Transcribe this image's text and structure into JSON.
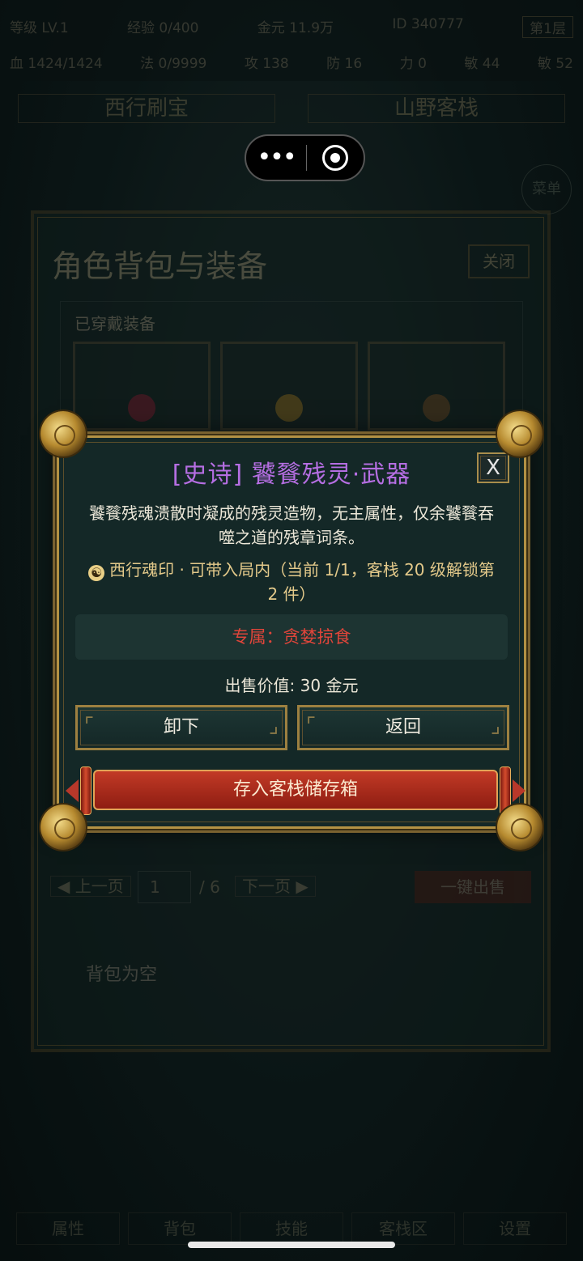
{
  "status": {
    "row1": [
      "等级 LV.1",
      "经验 0/400",
      "金元 11.9万",
      "ID 340777"
    ],
    "level_button": "第1层",
    "row2": [
      "血 1424/1424",
      "法 0/9999",
      "攻 138",
      "防 16",
      "力 0",
      "敏 44",
      "敏 52"
    ]
  },
  "nav": {
    "tab1": "西行刷宝",
    "tab2": "山野客栈"
  },
  "menu_label": "菜单",
  "bag": {
    "title": "角色背包与装备",
    "close_label": "关闭",
    "equipped_label": "已穿戴装备",
    "prev_page": "上一页",
    "page": "1",
    "page_total": "/ 6",
    "next_page": "下一页",
    "sell_all": "一键出售",
    "empty_text": "背包为空"
  },
  "dialog": {
    "title": "[史诗] 饕餮残灵·武器",
    "close_x": "X",
    "description": "饕餮残魂溃散时凝成的残灵造物，无主属性，仅余饕餮吞噬之道的残章词条。",
    "soul_icon": "yin-yang-icon",
    "soul_line": "西行魂印 · 可带入局内（当前 1/1，客栈 20 级解锁第 2 件）",
    "exclusive": "专属：贪婪掠食",
    "price": "出售价值: 30 金元",
    "unequip_label": "卸下",
    "back_label": "返回",
    "store_label": "存入客栈储存箱"
  },
  "bottom_nav": [
    "属性",
    "背包",
    "技能",
    "客栈区",
    "设置"
  ],
  "colors": {
    "epic_purple": "#b56ee2",
    "exclusive_red": "#e0453a",
    "gold_border": "#b39244",
    "store_red": "#c23a26"
  }
}
